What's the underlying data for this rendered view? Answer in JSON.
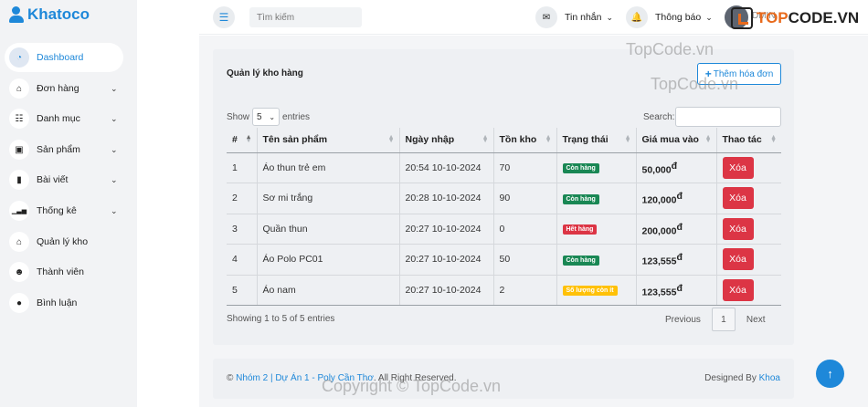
{
  "brand": {
    "name": "Khatoco"
  },
  "sidebar": {
    "items": [
      {
        "label": "Dashboard",
        "icon": "dashboard-icon",
        "active": true,
        "has_chevron": false
      },
      {
        "label": "Đơn hàng",
        "icon": "basket-icon",
        "active": false,
        "has_chevron": true
      },
      {
        "label": "Danh mục",
        "icon": "grid-icon",
        "active": false,
        "has_chevron": true
      },
      {
        "label": "Sản phẩm",
        "icon": "box-icon",
        "active": false,
        "has_chevron": true
      },
      {
        "label": "Bài viết",
        "icon": "book-icon",
        "active": false,
        "has_chevron": true
      },
      {
        "label": "Thống kê",
        "icon": "chart-icon",
        "active": false,
        "has_chevron": true
      },
      {
        "label": "Quản lý kho",
        "icon": "warehouse-icon",
        "active": false,
        "has_chevron": false
      },
      {
        "label": "Thành viên",
        "icon": "users-icon",
        "active": false,
        "has_chevron": false
      },
      {
        "label": "Bình luận",
        "icon": "comment-icon",
        "active": false,
        "has_chevron": false
      }
    ]
  },
  "topbar": {
    "search_placeholder": "Tìm kiếm",
    "messages_label": "Tin nhắn",
    "notifications_label": "Thông báo",
    "user_name": "DMIN"
  },
  "card": {
    "title": "Quản lý kho hàng",
    "add_button_label": "Thêm hóa đơn",
    "show_label": "Show",
    "entries_label": "entries",
    "page_length": "5",
    "search_label": "Search:",
    "columns": [
      "#",
      "Tên sản phẩm",
      "Ngày nhập",
      "Tồn kho",
      "Trạng thái",
      "Giá mua vào",
      "Thao tác"
    ],
    "rows": [
      {
        "index": "1",
        "name": "Áo thun trẻ em",
        "date": "20:54 10-10-2024",
        "stock": "70",
        "status": "Còn hàng",
        "status_color": "#198754",
        "price": "50,000",
        "currency": "đ",
        "action": "Xóa"
      },
      {
        "index": "2",
        "name": "Sơ mi trắng",
        "date": "20:28 10-10-2024",
        "stock": "90",
        "status": "Còn hàng",
        "status_color": "#198754",
        "price": "120,000",
        "currency": "đ",
        "action": "Xóa"
      },
      {
        "index": "3",
        "name": "Quần thun",
        "date": "20:27 10-10-2024",
        "stock": "0",
        "status": "Hết hàng",
        "status_color": "#dc3545",
        "price": "200,000",
        "currency": "đ",
        "action": "Xóa"
      },
      {
        "index": "4",
        "name": "Áo Polo PC01",
        "date": "20:27 10-10-2024",
        "stock": "50",
        "status": "Còn hàng",
        "status_color": "#198754",
        "price": "123,555",
        "currency": "đ",
        "action": "Xóa"
      },
      {
        "index": "5",
        "name": "Áo nam",
        "date": "20:27 10-10-2024",
        "stock": "2",
        "status": "Số lượng còn ít",
        "status_color": "#ffc107",
        "price": "123,555",
        "currency": "đ",
        "action": "Xóa"
      }
    ],
    "showing_text": "Showing 1 to 5 of 5 entries",
    "pagination": {
      "prev": "Previous",
      "current": "1",
      "next": "Next"
    }
  },
  "footer": {
    "copyright": "©",
    "link_text": "Nhóm 2 | Dự Án 1 - Poly Cần Thơ",
    "rights": ". All Right Reserved.",
    "designed_by": "Designed By",
    "designer": "Khoa"
  },
  "watermark": {
    "logo_prefix": "TOP",
    "logo_suffix": "CODE.VN",
    "text1": "TopCode.vn",
    "text2": "TopCode.vn",
    "text3": "Copyright © TopCode.vn"
  },
  "colors": {
    "accent": "#1e88d9",
    "danger": "#dc3545",
    "success": "#198754",
    "warning": "#ffc107"
  }
}
